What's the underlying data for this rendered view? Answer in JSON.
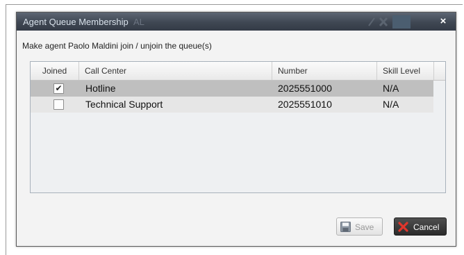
{
  "dialog": {
    "title": "Agent Queue Membership",
    "ghost_title": "AL",
    "close_glyph": "×",
    "instruction": "Make agent Paolo Maldini join / unjoin the queue(s)"
  },
  "table": {
    "columns": [
      "Joined",
      "Call Center",
      "Number",
      "Skill Level"
    ],
    "rows": [
      {
        "joined": true,
        "joined_glyph": "✔",
        "call_center": "Hotline",
        "number": "2025551000",
        "skill_level": "N/A",
        "selected": true
      },
      {
        "joined": false,
        "joined_glyph": "",
        "call_center": "Technical Support",
        "number": "2025551010",
        "skill_level": "N/A",
        "selected": false
      }
    ]
  },
  "buttons": {
    "save": {
      "label": "Save",
      "enabled": false,
      "icon": "floppy-disk-icon"
    },
    "cancel": {
      "label": "Cancel",
      "enabled": true,
      "icon": "red-x-icon"
    }
  },
  "colors": {
    "titlebar": "#3f4753",
    "selected_row": "#bfbfbf",
    "cancel_icon": "#e0362c"
  }
}
